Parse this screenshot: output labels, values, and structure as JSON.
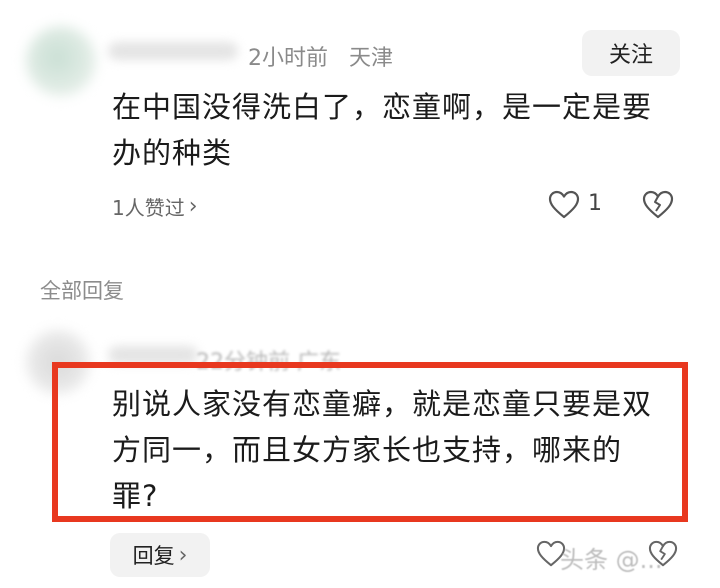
{
  "comment": {
    "time": "2小时前",
    "location": "天津",
    "follow_label": "关注",
    "text_line1": "在中国没得洗白了，恋童啊，是一定是要",
    "text_line2": "办的种类",
    "likes_summary": "1人赞过",
    "like_count": "1"
  },
  "replies_section": {
    "title": "全部回复"
  },
  "reply": {
    "time_location_faded": "22分钟前  广东",
    "text_line1": "别说人家没有恋童癖，就是恋童只要是双",
    "text_line2": "方同一，而且女方家长也支持，哪来的",
    "text_line3": "罪?",
    "reply_label": "回复",
    "watermark_text": "头条 @..."
  },
  "colors": {
    "highlight_border": "#e8381f",
    "button_bg": "#f2f2f2",
    "meta_text": "#8a8a8a"
  },
  "icons": {
    "like": "heart-outline-icon",
    "dislike": "broken-heart-icon",
    "chevron": "chevron-right-icon"
  }
}
